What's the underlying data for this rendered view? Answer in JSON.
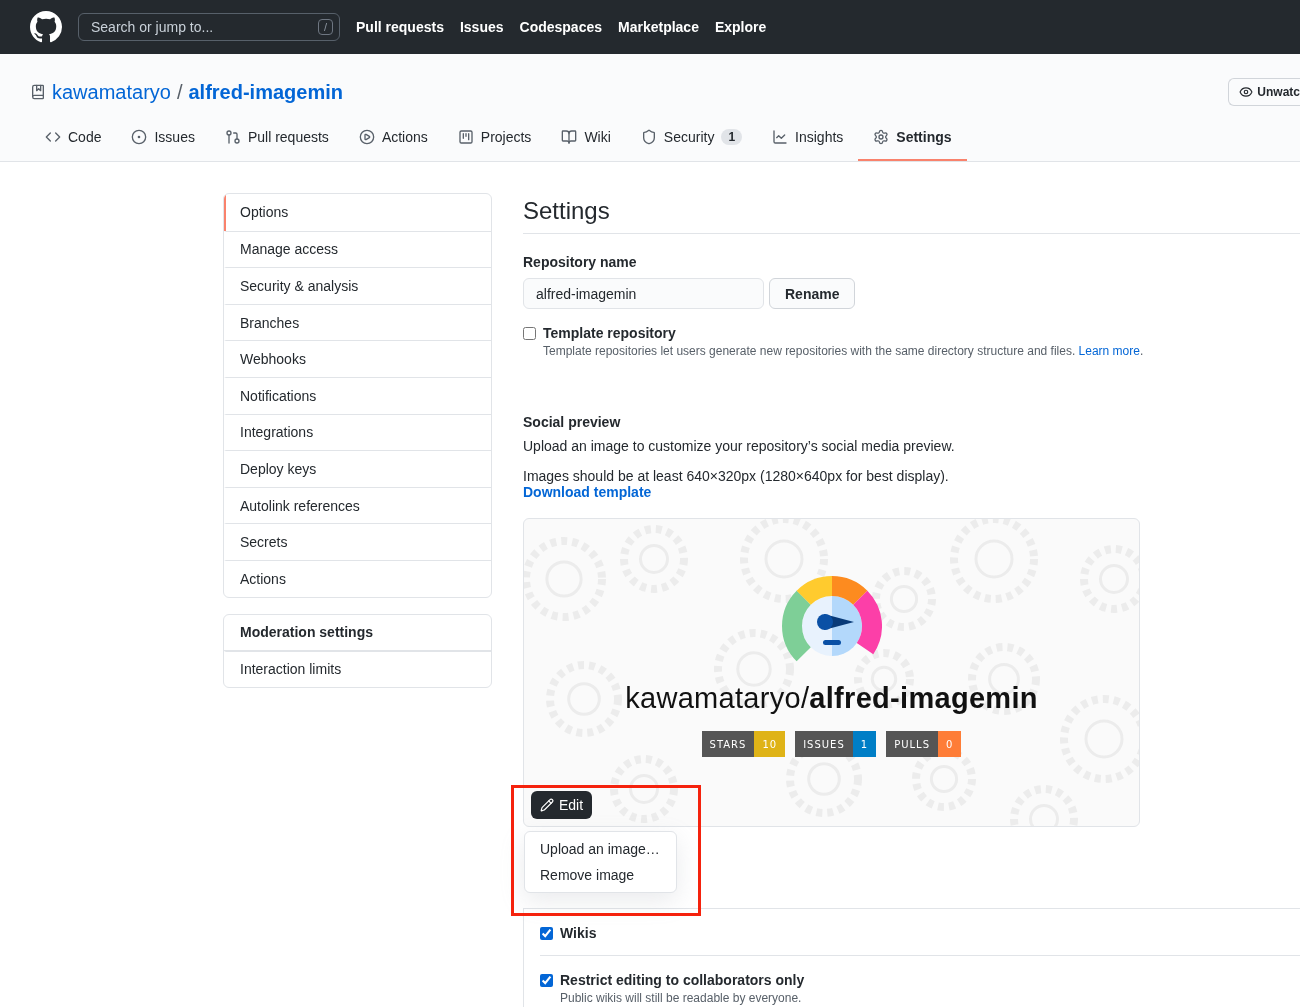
{
  "header": {
    "search_placeholder": "Search or jump to...",
    "search_key": "/",
    "nav": [
      "Pull requests",
      "Issues",
      "Codespaces",
      "Marketplace",
      "Explore"
    ]
  },
  "repo": {
    "owner": "kawamataryo",
    "separator": "/",
    "name": "alfred-imagemin",
    "watch_button": "Unwatc"
  },
  "tabs": [
    {
      "label": "Code",
      "selected": false
    },
    {
      "label": "Issues",
      "selected": false
    },
    {
      "label": "Pull requests",
      "selected": false
    },
    {
      "label": "Actions",
      "selected": false
    },
    {
      "label": "Projects",
      "selected": false
    },
    {
      "label": "Wiki",
      "selected": false
    },
    {
      "label": "Security",
      "counter": "1",
      "selected": false
    },
    {
      "label": "Insights",
      "selected": false
    },
    {
      "label": "Settings",
      "selected": true
    }
  ],
  "sidebar": {
    "groups": [
      {
        "items": [
          {
            "label": "Options",
            "selected": true
          },
          {
            "label": "Manage access",
            "selected": false
          },
          {
            "label": "Security & analysis",
            "selected": false
          },
          {
            "label": "Branches",
            "selected": false
          },
          {
            "label": "Webhooks",
            "selected": false
          },
          {
            "label": "Notifications",
            "selected": false
          },
          {
            "label": "Integrations",
            "selected": false
          },
          {
            "label": "Deploy keys",
            "selected": false
          },
          {
            "label": "Autolink references",
            "selected": false
          },
          {
            "label": "Secrets",
            "selected": false
          },
          {
            "label": "Actions",
            "selected": false
          }
        ]
      },
      {
        "heading": "Moderation settings",
        "items": [
          {
            "label": "Interaction limits",
            "selected": false
          }
        ]
      }
    ]
  },
  "settings": {
    "title": "Settings",
    "repo_name_label": "Repository name",
    "repo_name_value": "alfred-imagemin",
    "rename_button": "Rename",
    "template": {
      "label": "Template repository",
      "checked": false,
      "note": "Template repositories let users generate new repositories with the same directory structure and files.",
      "link": "Learn more",
      "trail": "."
    },
    "social": {
      "heading": "Social preview",
      "text_1": "Upload an image to customize your repository’s social media preview.",
      "text_2": "Images should be at least 640×320px (1280×640px for best display).",
      "link": "Download template",
      "preview_title": "kawamataryo/**alfred-imagemin**",
      "badges": [
        {
          "label": "STARS",
          "value": "10",
          "color": "#dfb317"
        },
        {
          "label": "ISSUES",
          "value": "1",
          "color": "#007ec6"
        },
        {
          "label": "PULLS",
          "value": "0",
          "color": "#fe7d37"
        }
      ],
      "edit_button": "Edit",
      "menu": [
        "Upload an image…",
        "Remove image"
      ]
    },
    "features": [
      {
        "label": "Wikis",
        "checked": true
      },
      {
        "label": "Restrict editing to collaborators only",
        "checked": true,
        "note": "Public wikis will still be readable by everyone."
      }
    ]
  }
}
